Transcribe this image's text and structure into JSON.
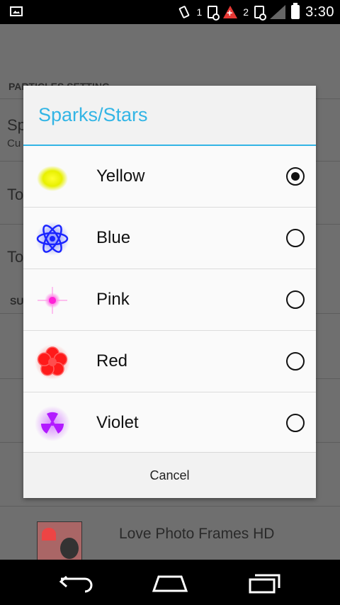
{
  "status_bar": {
    "notification_count_1": "1",
    "notification_count_2": "2",
    "time": "3:30"
  },
  "background": {
    "section_header": "PARTICLES SETTING",
    "row1_title": "Sp",
    "row1_sub": "Cu",
    "row2_title": "To",
    "row3_title": "To",
    "section2_header": "SU",
    "app_label": "Love Photo Frames HD"
  },
  "dialog": {
    "title": "Sparks/Stars",
    "options": [
      {
        "label": "Yellow",
        "selected": true,
        "color": "#f0f000",
        "icon": "yellow-glow-dot-icon"
      },
      {
        "label": "Blue",
        "selected": false,
        "color": "#1a24ff",
        "icon": "blue-atom-icon"
      },
      {
        "label": "Pink",
        "selected": false,
        "color": "#ff22d6",
        "icon": "pink-sparkle-icon"
      },
      {
        "label": "Red",
        "selected": false,
        "color": "#ff1a1a",
        "icon": "red-flower-icon"
      },
      {
        "label": "Violet",
        "selected": false,
        "color": "#b21aff",
        "icon": "violet-trefoil-icon"
      }
    ],
    "cancel_label": "Cancel"
  },
  "colors": {
    "accent": "#33b5e5"
  }
}
